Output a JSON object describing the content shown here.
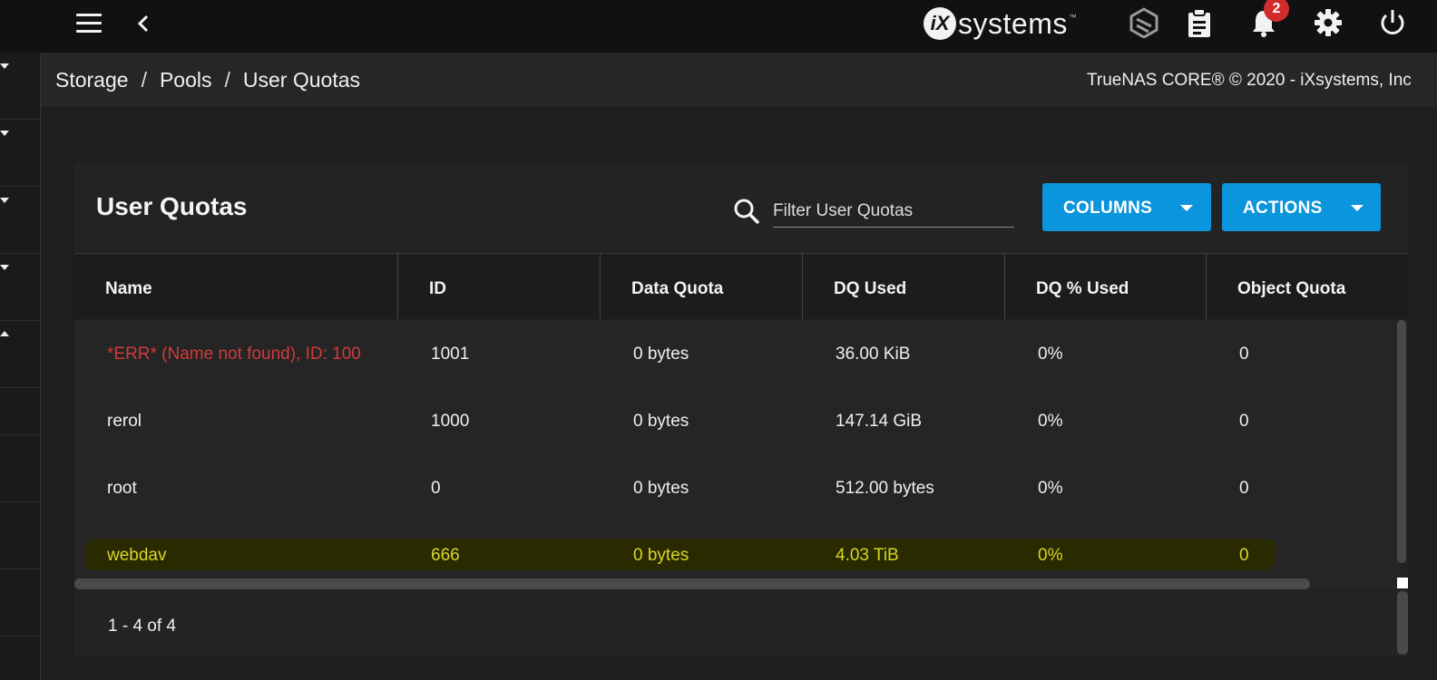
{
  "topbar": {
    "logo_badge": "iX",
    "logo_word": "systems",
    "logo_tm": "™",
    "notifications_count": "2",
    "icons": [
      "menu-icon",
      "back-arrow-icon",
      "truecommand-icon",
      "clipboard-icon",
      "bell-icon",
      "gear-icon",
      "power-icon"
    ]
  },
  "breadcrumb": {
    "items": [
      "Storage",
      "Pools",
      "User Quotas"
    ],
    "separator": "/"
  },
  "copyright": "TrueNAS CORE® © 2020 - iXsystems, Inc",
  "card": {
    "title": "User Quotas",
    "filter_placeholder": "Filter User Quotas",
    "columns_button": "COLUMNS",
    "actions_button": "ACTIONS"
  },
  "table": {
    "headers": [
      "Name",
      "ID",
      "Data Quota",
      "DQ Used",
      "DQ % Used",
      "Object Quota"
    ],
    "rows": [
      {
        "name": "*ERR* (Name not found), ID: 100",
        "id": "1001",
        "data_quota": "0 bytes",
        "dq_used": "36.00 KiB",
        "dq_pct": "0%",
        "object_quota": "0",
        "error": true
      },
      {
        "name": "rerol",
        "id": "1000",
        "data_quota": "0 bytes",
        "dq_used": "147.14 GiB",
        "dq_pct": "0%",
        "object_quota": "0"
      },
      {
        "name": "root",
        "id": "0",
        "data_quota": "0 bytes",
        "dq_used": "512.00 bytes",
        "dq_pct": "0%",
        "object_quota": "0"
      },
      {
        "name": "webdav",
        "id": "666",
        "data_quota": "0 bytes",
        "dq_used": "4.03 TiB",
        "dq_pct": "0%",
        "object_quota": "0",
        "highlighted": true
      }
    ]
  },
  "pagination": "1 - 4 of 4",
  "colors": {
    "accent": "#0a95dc",
    "error_text": "#d23a3a",
    "highlight_text": "#d6d629",
    "badge": "#d12c2c"
  }
}
